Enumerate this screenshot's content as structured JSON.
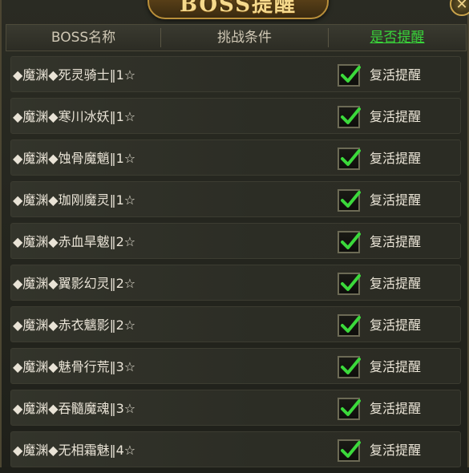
{
  "title": "BOSS提醒",
  "close_symbol": "✕",
  "header": {
    "col_name": "BOSS名称",
    "col_condition": "挑战条件",
    "col_remind": "是否提醒"
  },
  "colors": {
    "active_header": "#39d43a",
    "check": "#3bd93b",
    "title_gold": "#f6d98c"
  },
  "rows": [
    {
      "name": "◆魔渊◆死灵骑士‖1☆",
      "checked": true,
      "label": "复活提醒"
    },
    {
      "name": "◆魔渊◆寒川冰妖‖1☆",
      "checked": true,
      "label": "复活提醒"
    },
    {
      "name": "◆魔渊◆蚀骨魔魈‖1☆",
      "checked": true,
      "label": "复活提醒"
    },
    {
      "name": "◆魔渊◆珈刚魔灵‖1☆",
      "checked": true,
      "label": "复活提醒"
    },
    {
      "name": "◆魔渊◆赤血旱魃‖2☆",
      "checked": true,
      "label": "复活提醒"
    },
    {
      "name": "◆魔渊◆翼影幻灵‖2☆",
      "checked": true,
      "label": "复活提醒"
    },
    {
      "name": "◆魔渊◆赤衣魑影‖2☆",
      "checked": true,
      "label": "复活提醒"
    },
    {
      "name": "◆魔渊◆魅骨行荒‖3☆",
      "checked": true,
      "label": "复活提醒"
    },
    {
      "name": "◆魔渊◆吞髓魔魂‖3☆",
      "checked": true,
      "label": "复活提醒"
    },
    {
      "name": "◆魔渊◆无相霜魅‖4☆",
      "checked": true,
      "label": "复活提醒"
    }
  ]
}
